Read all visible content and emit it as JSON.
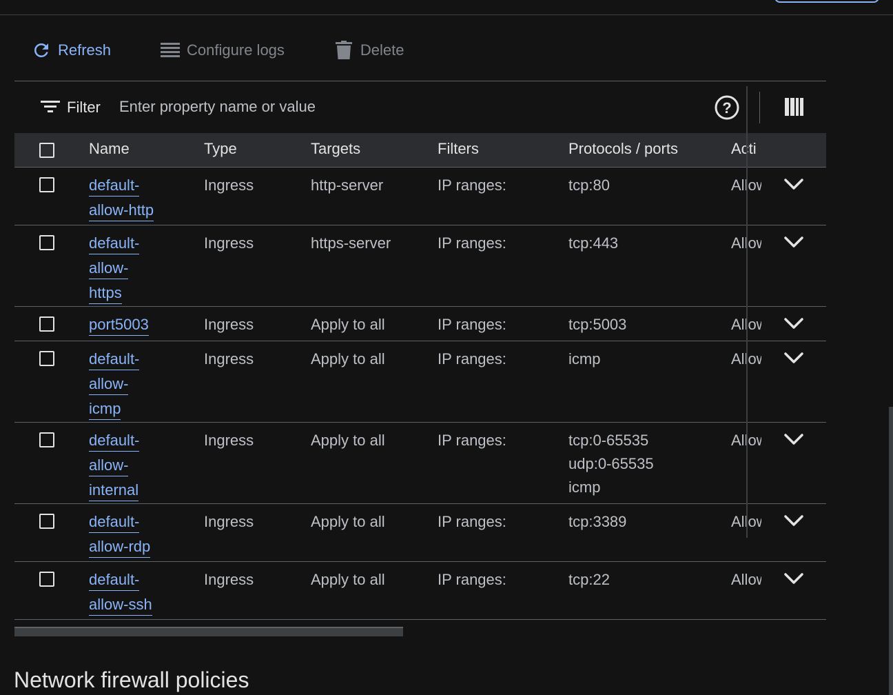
{
  "toolbar": {
    "refresh_label": "Refresh",
    "configure_logs_label": "Configure logs",
    "delete_label": "Delete"
  },
  "filter": {
    "label": "Filter",
    "placeholder": "Enter property name or value"
  },
  "table": {
    "columns": {
      "name": "Name",
      "type": "Type",
      "targets": "Targets",
      "filters": "Filters",
      "protocols": "Protocols / ports",
      "action": "Acti"
    },
    "rows": [
      {
        "name_lines": [
          "default-",
          "allow-http"
        ],
        "type": "Ingress",
        "targets": "http-server",
        "filters": "IP ranges:",
        "protocols": [
          "tcp:80"
        ],
        "action": "Allow"
      },
      {
        "name_lines": [
          "default-",
          "allow-",
          "https"
        ],
        "type": "Ingress",
        "targets": "https-server",
        "filters": "IP ranges:",
        "protocols": [
          "tcp:443"
        ],
        "action": "Allow"
      },
      {
        "name_lines": [
          "port5003"
        ],
        "type": "Ingress",
        "targets": "Apply to all",
        "filters": "IP ranges:",
        "protocols": [
          "tcp:5003"
        ],
        "action": "Allow"
      },
      {
        "name_lines": [
          "default-",
          "allow-",
          "icmp"
        ],
        "type": "Ingress",
        "targets": "Apply to all",
        "filters": "IP ranges:",
        "protocols": [
          "icmp"
        ],
        "action": "Allow"
      },
      {
        "name_lines": [
          "default-",
          "allow-",
          "internal"
        ],
        "type": "Ingress",
        "targets": "Apply to all",
        "filters": "IP ranges:",
        "protocols": [
          "tcp:0-65535",
          "udp:0-65535",
          "icmp"
        ],
        "action": "Allow"
      },
      {
        "name_lines": [
          "default-",
          "allow-rdp"
        ],
        "type": "Ingress",
        "targets": "Apply to all",
        "filters": "IP ranges:",
        "protocols": [
          "tcp:3389"
        ],
        "action": "Allow"
      },
      {
        "name_lines": [
          "default-",
          "allow-ssh"
        ],
        "type": "Ingress",
        "targets": "Apply to all",
        "filters": "IP ranges:",
        "protocols": [
          "tcp:22"
        ],
        "action": "Allow"
      }
    ]
  },
  "section": {
    "title": "Network firewall policies"
  },
  "colors": {
    "background": "#131314",
    "link": "#8ab4f8",
    "header_bg": "#2c2d30"
  }
}
